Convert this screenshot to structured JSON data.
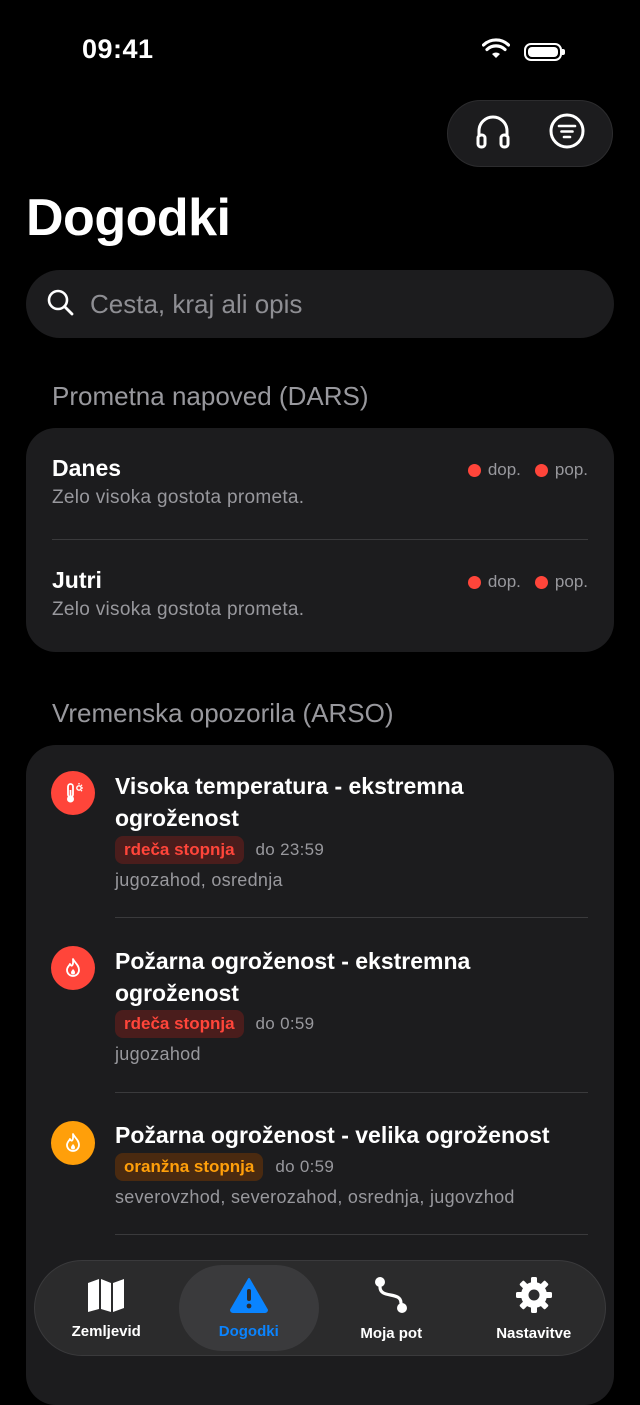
{
  "status_bar": {
    "time": "09:41"
  },
  "page_title": "Dogodki",
  "search": {
    "placeholder": "Cesta, kraj ali opis"
  },
  "traffic_section": {
    "title": "Prometna napoved (DARS)",
    "rows": [
      {
        "day": "Danes",
        "description": "Zelo visoka gostota prometa.",
        "morning": "dop.",
        "afternoon": "pop."
      },
      {
        "day": "Jutri",
        "description": "Zelo visoka gostota prometa.",
        "morning": "dop.",
        "afternoon": "pop."
      }
    ]
  },
  "weather_section": {
    "title": "Vremenska opozorila (ARSO)",
    "warnings": [
      {
        "title": "Visoka temperatura - ekstremna ogroženost",
        "level": "rdeča stopnja",
        "until": "do 23:59",
        "regions": "jugozahod, osrednja",
        "icon": "thermometer-icon",
        "color": "#ff453a"
      },
      {
        "title": "Požarna ogroženost - ekstremna ogroženost",
        "level": "rdeča stopnja",
        "until": "do 0:59",
        "regions": "jugozahod",
        "icon": "fire-icon",
        "color": "#ff453a"
      },
      {
        "title": "Požarna ogroženost - velika ogroženost",
        "level": "oranžna stopnja",
        "until": "do 0:59",
        "regions": "severovzhod, severozahod, osrednja, jugovzhod",
        "icon": "fire-icon",
        "color": "#ff9f0a"
      }
    ]
  },
  "tab_bar": {
    "tabs": [
      {
        "label": "Zemljevid",
        "icon": "map-icon"
      },
      {
        "label": "Dogodki",
        "icon": "warning-icon",
        "active": true
      },
      {
        "label": "Moja pot",
        "icon": "route-icon"
      },
      {
        "label": "Nastavitve",
        "icon": "gear-icon"
      }
    ]
  },
  "colors": {
    "accent": "#0a84ff",
    "red": "#ff453a",
    "orange": "#ff9f0a",
    "card": "#1c1c1e"
  }
}
